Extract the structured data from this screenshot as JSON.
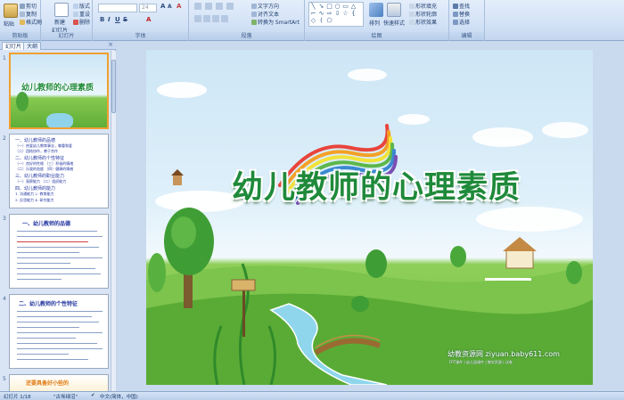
{
  "ribbon": {
    "clipboard": {
      "label": "剪贴板",
      "paste": "粘贴",
      "cut": "剪切",
      "copy": "复制",
      "format_painter": "格式刷"
    },
    "slides": {
      "label": "幻灯片",
      "new_slide": "新建",
      "new_slide2": "幻灯片",
      "layout": "版式",
      "reset": "重设",
      "delete": "删除"
    },
    "font": {
      "label": "字体",
      "size": "24",
      "clear": "A"
    },
    "paragraph": {
      "label": "段落",
      "text_direction": "文字方向",
      "align_text": "对齐文本",
      "smartart": "转换为 SmartArt"
    },
    "drawing": {
      "label": "绘图",
      "arrange": "排列",
      "quick_styles": "快速样式",
      "fill": "形状填充",
      "outline": "形状轮廓",
      "effects": "形状效果"
    },
    "editing": {
      "label": "编辑",
      "find": "查找",
      "replace": "替换",
      "select": "选择"
    }
  },
  "pane": {
    "tab_slides": "幻灯片",
    "tab_outline": "大纲",
    "thumbs": [
      {
        "num": "1",
        "title": "幼儿教师的心理素质"
      },
      {
        "num": "2",
        "lines": [
          "一、幼儿教师的品德",
          "（一）热爱幼儿教育事业，尊重和爱",
          "（二）团结协作，善于合作",
          "二、幼儿教师的个性特征",
          "（一）良好的性格  （三）积极的情绪",
          "（二）乐观的态度  （四）健康的情感",
          "三、幼儿教师的职业能力",
          "（一）观察能力 （二）组织能力",
          "四、幼儿教师的能力",
          "1. 沟通能力  2. 教育能力",
          "3. 反思能力  4. 研究能力"
        ]
      },
      {
        "num": "3",
        "title": "一、幼儿教师的品德"
      },
      {
        "num": "4",
        "title": "二、幼儿教师的个性特征"
      },
      {
        "num": "5",
        "title": "还要具备好小些的"
      }
    ]
  },
  "slide": {
    "title": "幼儿教师的心理素质",
    "watermark": "幼教资源网 ziyuan.baby611.com",
    "watermark_sub": "FPT课件 | 幼儿园课件 | 教学资源 | 试卷"
  },
  "status": {
    "slide_count": "幻灯片 1/18",
    "theme": "\"古埃绿沼\"",
    "language": "中文(简体，中国)"
  },
  "colors": {
    "ribbon": "#d3e2f6",
    "title_green": "#1f8a3a",
    "selected_border": "#f0a030"
  }
}
